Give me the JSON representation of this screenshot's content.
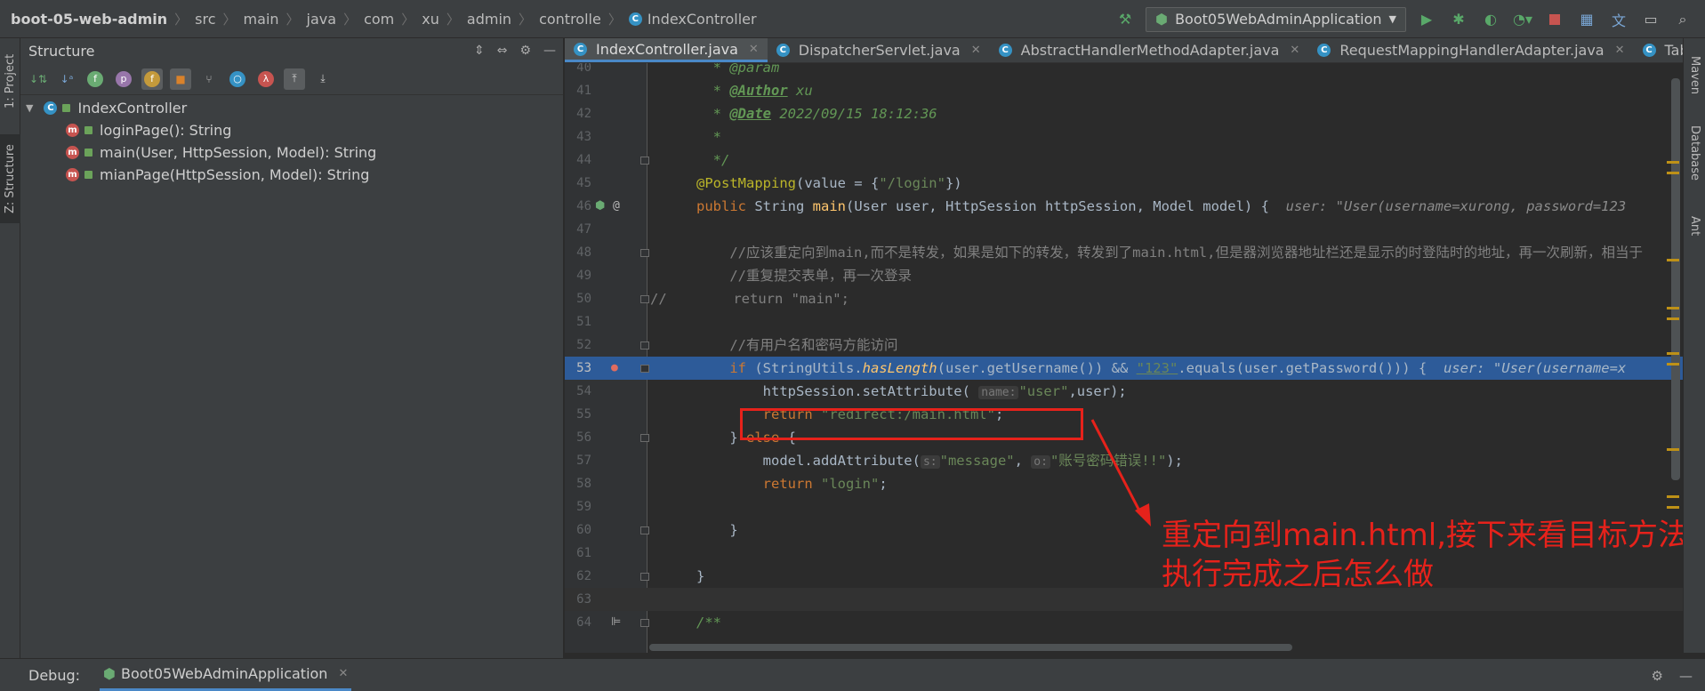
{
  "breadcrumb": [
    "boot-05-web-admin",
    "src",
    "main",
    "java",
    "com",
    "xu",
    "admin",
    "controlle",
    "IndexController"
  ],
  "run_config": "Boot05WebAdminApplication",
  "left_tabs": {
    "project": "1: Project",
    "structure": "Z: Structure"
  },
  "right_tabs": {
    "maven": "Maven",
    "database": "Database",
    "other": "Ant"
  },
  "structure": {
    "title": "Structure",
    "root": "IndexController",
    "items": [
      "loginPage(): String",
      "main(User, HttpSession, Model): String",
      "mianPage(HttpSession, Model): String"
    ]
  },
  "tabs": [
    "IndexController.java",
    "DispatcherServlet.java",
    "AbstractHandlerMethodAdapter.java",
    "RequestMappingHandlerAdapter.java",
    "TableContr"
  ],
  "code": {
    "l40_doc": "* @param",
    "l41_tag": "@Author",
    "l41_val": " xu",
    "l42_tag": "@Date",
    "l42_val": " 2022/09/15 18:12:36",
    "l43": "*",
    "l44": "*/",
    "l45_ann": "@PostMapping",
    "l45_rest1": "(value = {",
    "l45_str": "\"/login\"",
    "l45_rest2": "})",
    "l46_kw": "public ",
    "l46_type": "String ",
    "l46_fn": "main",
    "l46_rest": "(User user, HttpSession httpSession, Model model) {",
    "l46_inline": "user: \"User(username=xurong, password=123",
    "l48": "//应该重定向到main,而不是转发，如果是如下的转发，转发到了main.html,但是器浏览器地址栏还是显示的时登陆时的地址，再一次刷新，相当于",
    "l49": "//重复提交表单，再一次登录",
    "l50": "//        return \"main\";",
    "l52": "//有用户名和密码方能访问",
    "l53_kw": "if ",
    "l53_a": "(StringUtils.",
    "l53_fn": "hasLength",
    "l53_b": "(user.getUsername()) && ",
    "l53_str": "\"123\"",
    "l53_c": ".equals(user.getPassword())) {",
    "l53_inline": "user: \"User(username=x",
    "l54_a": "httpSession.setAttribute(",
    "l54_hint": "name:",
    "l54_str": "\"user\"",
    "l54_b": ",user);",
    "l55_kw": "return ",
    "l55_str": "\"redirect:/main.html\"",
    "l55_end": ";",
    "l56_a": "} ",
    "l56_kw": "else",
    "l56_b": " {",
    "l57_a": "model.addAttribute(",
    "l57_hint1": "s:",
    "l57_str1": "\"message\"",
    "l57_comma": ", ",
    "l57_hint2": "o:",
    "l57_str2": "\"账号密码错误!!\"",
    "l57_b": ");",
    "l58_kw": "return ",
    "l58_str": "\"login\"",
    "l58_end": ";",
    "l60": "}",
    "l62": "}",
    "l64": "/**"
  },
  "line_numbers": [
    "40",
    "41",
    "42",
    "43",
    "44",
    "45",
    "46",
    "47",
    "48",
    "49",
    "50",
    "51",
    "52",
    "53",
    "54",
    "55",
    "56",
    "57",
    "58",
    "59",
    "60",
    "61",
    "62",
    "63",
    "64"
  ],
  "annotation": "重定向到main.html,接下来看目标方法执行完成之后怎么做",
  "debug": {
    "label": "Debug:",
    "session": "Boot05WebAdminApplication"
  }
}
